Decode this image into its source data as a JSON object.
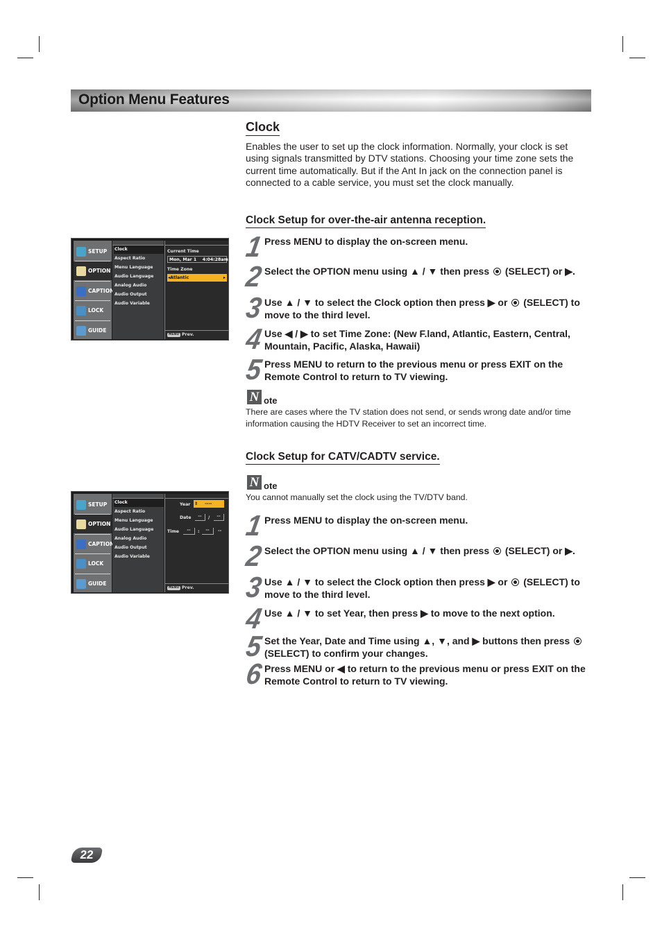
{
  "header": {
    "title": "Option Menu Features"
  },
  "clock": {
    "heading": "Clock",
    "description": "Enables the user to set up the clock information. Normally, your clock is set using signals transmitted by DTV stations. Choosing your time zone sets the current time automatically. But if the Ant In jack on the connection panel is connected to a cable service, you must set the clock manually."
  },
  "antenna": {
    "heading": "Clock Setup for over-the-air antenna reception.",
    "steps": [
      {
        "num": "1",
        "text": "Press MENU to display the on-screen menu."
      },
      {
        "num": "2",
        "pre": "Select the OPTION menu using ▲ / ▼ then press ",
        "post": " (SELECT) or ▶."
      },
      {
        "num": "3",
        "pre": "Use ▲ / ▼ to select the Clock option then press ▶ or ",
        "post": " (SELECT) to move to the third level."
      },
      {
        "num": "4",
        "text": "Use ◀ / ▶ to set Time Zone: (New F.land, Atlantic, Eastern, Central, Mountain, Pacific, Alaska, Hawaii)"
      },
      {
        "num": "5",
        "text": "Press MENU to return to the previous menu or press EXIT on the Remote Control to return to TV viewing."
      }
    ],
    "note": {
      "icon_letter": "N",
      "label": "ote",
      "text": "There are cases where the TV station does not send, or sends wrong date and/or time information causing the HDTV Receiver to set an incorrect time."
    }
  },
  "catv": {
    "heading": "Clock Setup for CATV/CADTV service.",
    "note": {
      "icon_letter": "N",
      "label": "ote",
      "text": "You cannot manually set the clock using the TV/DTV band."
    },
    "steps": [
      {
        "num": "1",
        "text": "Press MENU to display the on-screen menu."
      },
      {
        "num": "2",
        "pre": "Select the OPTION menu using ▲ / ▼ then press ",
        "post": " (SELECT) or ▶."
      },
      {
        "num": "3",
        "pre": "Use ▲ / ▼ to select the Clock option then press ▶ or ",
        "post": " (SELECT) to move to the third level."
      },
      {
        "num": "4",
        "text": "Use ▲ / ▼ to set Year, then press ▶ to move to the next option."
      },
      {
        "num": "5",
        "pre": "Set the Year, Date and Time using ▲, ▼, and ▶ buttons then press ",
        "post": " (SELECT) to confirm your changes."
      },
      {
        "num": "6",
        "text": "Press MENU or ◀ to return to the previous menu or press EXIT on the Remote Control to return to TV viewing."
      }
    ]
  },
  "tv_menu": {
    "side_items": [
      "SETUP",
      "OPTION",
      "CAPTION",
      "LOCK",
      "GUIDE"
    ],
    "active_side": "OPTION",
    "menu_items": [
      "Clock",
      "Aspect Ratio",
      "Menu Language",
      "Audio Language",
      "Analog Audio",
      "Audio Output",
      "Audio Variable"
    ],
    "active_item": "Clock",
    "footer_key": "MENU",
    "footer_label": "Prev.",
    "screen1": {
      "current_time_label": "Current Time",
      "current_time_value": "Mon, Mar 1    4:04:28am",
      "time_zone_label": "Time Zone",
      "time_zone_value": "Atlantic"
    },
    "screen2": {
      "year_label": "Year",
      "year_value": "----",
      "date_label": "Date",
      "date_month": "--",
      "date_sep": "/",
      "date_day": "--",
      "time_label": "Time",
      "time_hour": "--",
      "time_sep": ":",
      "time_min": "--",
      "time_ampm": "--"
    }
  },
  "page_number": "22"
}
